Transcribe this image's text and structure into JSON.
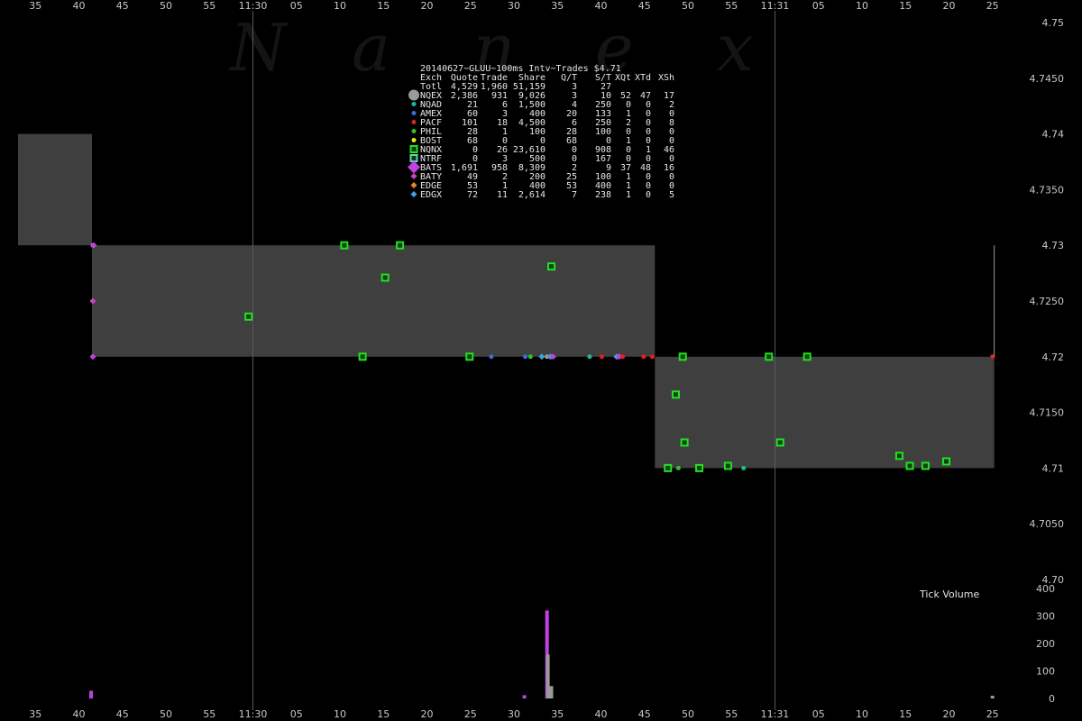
{
  "chart_data": {
    "type": "scatter",
    "title": "20140627~GLUU~100ms Intv~Trades $4.71",
    "watermark": "Nanex",
    "volume_label": "Tick Volume",
    "x_ticks_top": [
      "35",
      "40",
      "45",
      "50",
      "55",
      "11:30",
      "05",
      "10",
      "15",
      "20",
      "25",
      "30",
      "35",
      "40",
      "45",
      "50",
      "55",
      "11:31",
      "05",
      "10",
      "15",
      "20",
      "25"
    ],
    "x_ticks_bottom": [
      "35",
      "40",
      "45",
      "50",
      "55",
      "11:30",
      "05",
      "10",
      "15",
      "20",
      "25",
      "30",
      "35",
      "40",
      "45",
      "50",
      "55",
      "11:31",
      "05",
      "10",
      "15",
      "20",
      "25"
    ],
    "x_tick_seconds": [
      -25,
      -20,
      -15,
      -10,
      -5,
      0,
      5,
      10,
      15,
      20,
      25,
      30,
      35,
      40,
      45,
      50,
      55,
      60,
      65,
      70,
      75,
      80,
      85
    ],
    "x_range_seconds": [
      -27,
      87
    ],
    "x_unit": "seconds after 11:30:00",
    "y_ticks": [
      "4.75",
      "4.7450",
      "4.74",
      "4.7350",
      "4.73",
      "4.7250",
      "4.72",
      "4.7150",
      "4.71",
      "4.7050",
      "4.70"
    ],
    "ylim": [
      4.7,
      4.75
    ],
    "volume_ticks": [
      "400",
      "300",
      "200",
      "100",
      "0"
    ],
    "volume_ylim": [
      0,
      400
    ],
    "colors": {
      "background": "#000000",
      "nbbo_band": "#3f3f3f",
      "grid": "#5a5a5a",
      "text": "#c8c8c8"
    },
    "nbbo_bands": [
      {
        "x_start": -27,
        "x_end": -18.5,
        "bid": 4.73,
        "ask": 4.74
      },
      {
        "x_start": -18.5,
        "x_end": 46.2,
        "bid": 4.72,
        "ask": 4.73
      },
      {
        "x_start": 46.2,
        "x_end": 85.2,
        "bid": 4.71,
        "ask": 4.72
      }
    ],
    "legend": {
      "columns": [
        "Exch",
        "Quote",
        "Trade",
        "Share",
        "Q/T",
        "S/T",
        "XQt",
        "XTd",
        "XSh"
      ],
      "rows": [
        {
          "exch": "Totl",
          "quote": "4,529",
          "trade": "1,960",
          "share": "51,159",
          "qt": "3",
          "st": "27",
          "xqt": "",
          "xtd": "",
          "xsh": "",
          "color": "",
          "marker": "none"
        },
        {
          "exch": "NQEX",
          "quote": "2,386",
          "trade": "931",
          "share": "9,026",
          "qt": "3",
          "st": "10",
          "xqt": "52",
          "xtd": "47",
          "xsh": "17",
          "color": "#9a9a9a",
          "marker": "big-circle"
        },
        {
          "exch": "NQAD",
          "quote": "21",
          "trade": "6",
          "share": "1,500",
          "qt": "4",
          "st": "250",
          "xqt": "0",
          "xtd": "0",
          "xsh": "2",
          "color": "#1fb89a",
          "marker": "circle"
        },
        {
          "exch": "AMEX",
          "quote": "60",
          "trade": "3",
          "share": "400",
          "qt": "20",
          "st": "133",
          "xqt": "1",
          "xtd": "0",
          "xsh": "0",
          "color": "#3a6fd8",
          "marker": "circle"
        },
        {
          "exch": "PACF",
          "quote": "101",
          "trade": "18",
          "share": "4,500",
          "qt": "6",
          "st": "250",
          "xqt": "2",
          "xtd": "0",
          "xsh": "8",
          "color": "#e02020",
          "marker": "circle"
        },
        {
          "exch": "PHIL",
          "quote": "28",
          "trade": "1",
          "share": "100",
          "qt": "28",
          "st": "100",
          "xqt": "0",
          "xtd": "0",
          "xsh": "0",
          "color": "#2fc02f",
          "marker": "circle"
        },
        {
          "exch": "BOST",
          "quote": "68",
          "trade": "0",
          "share": "0",
          "qt": "68",
          "st": "0",
          "xqt": "1",
          "xtd": "0",
          "xsh": "0",
          "color": "#e8e82a",
          "marker": "circle"
        },
        {
          "exch": "NQNX",
          "quote": "0",
          "trade": "26",
          "share": "23,610",
          "qt": "0",
          "st": "908",
          "xqt": "0",
          "xtd": "1",
          "xsh": "46",
          "color": "#22e022",
          "marker": "square"
        },
        {
          "exch": "NTRF",
          "quote": "0",
          "trade": "3",
          "share": "500",
          "qt": "0",
          "st": "167",
          "xqt": "0",
          "xtd": "0",
          "xsh": "0",
          "color": "#6ad0c0",
          "marker": "square"
        },
        {
          "exch": "BATS",
          "quote": "1,691",
          "trade": "958",
          "share": "8,309",
          "qt": "2",
          "st": "9",
          "xqt": "37",
          "xtd": "48",
          "xsh": "16",
          "color": "#c040e0",
          "marker": "big-diamond"
        },
        {
          "exch": "BATY",
          "quote": "49",
          "trade": "2",
          "share": "200",
          "qt": "25",
          "st": "100",
          "xqt": "1",
          "xtd": "0",
          "xsh": "0",
          "color": "#d040c0",
          "marker": "diamond"
        },
        {
          "exch": "EDGE",
          "quote": "53",
          "trade": "1",
          "share": "400",
          "qt": "53",
          "st": "400",
          "xqt": "1",
          "xtd": "0",
          "xsh": "0",
          "color": "#e08a20",
          "marker": "diamond"
        },
        {
          "exch": "EDGX",
          "quote": "72",
          "trade": "11",
          "share": "2,614",
          "qt": "7",
          "st": "238",
          "xqt": "1",
          "xtd": "0",
          "xsh": "5",
          "color": "#40a0e0",
          "marker": "diamond"
        }
      ]
    },
    "trades": [
      {
        "x": -18.4,
        "price": 4.73,
        "exch": "NQEX"
      },
      {
        "x": -18.3,
        "price": 4.73,
        "exch": "BATS"
      },
      {
        "x": -18.4,
        "price": 4.725,
        "exch": "BATY"
      },
      {
        "x": -18.4,
        "price": 4.72,
        "exch": "BATS"
      },
      {
        "x": -0.5,
        "price": 4.7236,
        "exch": "NQNX"
      },
      {
        "x": 10.5,
        "price": 4.73,
        "exch": "NQNX"
      },
      {
        "x": 15.2,
        "price": 4.7271,
        "exch": "NQNX"
      },
      {
        "x": 16.9,
        "price": 4.73,
        "exch": "NQNX"
      },
      {
        "x": 12.6,
        "price": 4.72,
        "exch": "NQNX"
      },
      {
        "x": 24.9,
        "price": 4.72,
        "exch": "NQNX"
      },
      {
        "x": 27.4,
        "price": 4.72,
        "exch": "AMEX"
      },
      {
        "x": 31.3,
        "price": 4.72,
        "exch": "AMEX"
      },
      {
        "x": 31.9,
        "price": 4.72,
        "exch": "PHIL"
      },
      {
        "x": 33.2,
        "price": 4.72,
        "exch": "EDGX"
      },
      {
        "x": 33.8,
        "price": 4.72,
        "exch": "NQEX"
      },
      {
        "x": 34.2,
        "price": 4.72,
        "exch": "EDGX"
      },
      {
        "x": 34.5,
        "price": 4.72,
        "exch": "BATS"
      },
      {
        "x": 34.3,
        "price": 4.7281,
        "exch": "NQNX"
      },
      {
        "x": 38.7,
        "price": 4.72,
        "exch": "NQAD"
      },
      {
        "x": 40.1,
        "price": 4.72,
        "exch": "PACF"
      },
      {
        "x": 41.8,
        "price": 4.72,
        "exch": "EDGX"
      },
      {
        "x": 42.1,
        "price": 4.72,
        "exch": "BATS"
      },
      {
        "x": 42.5,
        "price": 4.72,
        "exch": "PACF"
      },
      {
        "x": 44.9,
        "price": 4.72,
        "exch": "PACF"
      },
      {
        "x": 45.9,
        "price": 4.72,
        "exch": "PACF"
      },
      {
        "x": 49.4,
        "price": 4.72,
        "exch": "NQNX"
      },
      {
        "x": 48.6,
        "price": 4.7166,
        "exch": "NQNX"
      },
      {
        "x": 49.6,
        "price": 4.7123,
        "exch": "NQNX"
      },
      {
        "x": 47.7,
        "price": 4.71,
        "exch": "NQNX"
      },
      {
        "x": 48.9,
        "price": 4.71,
        "exch": "PHIL"
      },
      {
        "x": 51.3,
        "price": 4.71,
        "exch": "NQNX"
      },
      {
        "x": 54.6,
        "price": 4.7102,
        "exch": "NQNX"
      },
      {
        "x": 56.4,
        "price": 4.71,
        "exch": "NQAD"
      },
      {
        "x": 59.3,
        "price": 4.72,
        "exch": "NQNX"
      },
      {
        "x": 60.6,
        "price": 4.7123,
        "exch": "NQNX"
      },
      {
        "x": 63.7,
        "price": 4.72,
        "exch": "NQNX"
      },
      {
        "x": 74.3,
        "price": 4.7111,
        "exch": "NQNX"
      },
      {
        "x": 75.5,
        "price": 4.7102,
        "exch": "NQNX"
      },
      {
        "x": 77.3,
        "price": 4.7102,
        "exch": "NQNX"
      },
      {
        "x": 79.7,
        "price": 4.7106,
        "exch": "NQNX"
      },
      {
        "x": 85.0,
        "price": 4.72,
        "exch": "PACF"
      }
    ],
    "late_print": {
      "x": 85.2,
      "price_from": 4.72,
      "price_to": 4.73
    },
    "tick_volume": [
      {
        "x": -18.6,
        "value": 28,
        "color": "#c040e0"
      },
      {
        "x": 31.2,
        "value": 12,
        "color": "#c040e0"
      },
      {
        "x": 33.8,
        "value": 320,
        "color": "#c040e0"
      },
      {
        "x": 33.9,
        "value": 160,
        "color": "#9a9a9a"
      },
      {
        "x": 34.3,
        "value": 45,
        "color": "#9a9a9a"
      },
      {
        "x": 85.0,
        "value": 10,
        "color": "#9a9a9a"
      }
    ]
  }
}
